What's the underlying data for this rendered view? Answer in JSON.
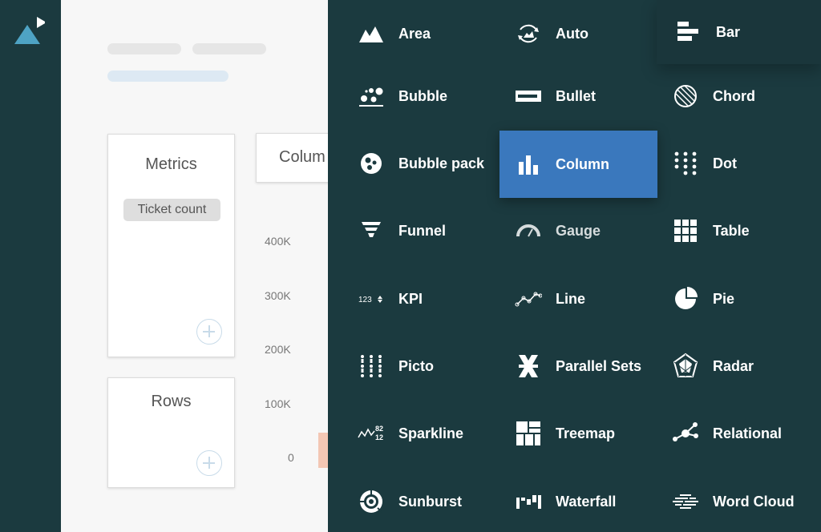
{
  "builder": {
    "metrics_title": "Metrics",
    "metric_chip": "Ticket count",
    "rows_title": "Rows",
    "column_title": "Colum",
    "y_ticks": [
      "400K",
      "300K",
      "200K",
      "100K",
      "0"
    ]
  },
  "picker": {
    "items": [
      {
        "label": "Area",
        "icon": "area-icon"
      },
      {
        "label": "Auto",
        "icon": "auto-icon"
      },
      {
        "label": "Bar",
        "icon": "bar-icon"
      },
      {
        "label": "Bubble",
        "icon": "bubble-icon"
      },
      {
        "label": "Bullet",
        "icon": "bullet-icon"
      },
      {
        "label": "Chord",
        "icon": "chord-icon"
      },
      {
        "label": "Bubble pack",
        "icon": "bubble-pack-icon"
      },
      {
        "label": "Column",
        "icon": "column-icon"
      },
      {
        "label": "Dot",
        "icon": "dot-icon"
      },
      {
        "label": "Funnel",
        "icon": "funnel-icon"
      },
      {
        "label": "Gauge",
        "icon": "gauge-icon"
      },
      {
        "label": "Table",
        "icon": "table-icon"
      },
      {
        "label": "KPI",
        "icon": "kpi-icon",
        "icon_text": "123"
      },
      {
        "label": "Line",
        "icon": "line-icon"
      },
      {
        "label": "Pie",
        "icon": "pie-icon"
      },
      {
        "label": "Picto",
        "icon": "picto-icon"
      },
      {
        "label": "Parallel Sets",
        "icon": "parallel-sets-icon"
      },
      {
        "label": "Radar",
        "icon": "radar-icon"
      },
      {
        "label": "Sparkline",
        "icon": "sparkline-icon",
        "icon_text_top": "82",
        "icon_text_bottom": "12"
      },
      {
        "label": "Treemap",
        "icon": "treemap-icon"
      },
      {
        "label": "Relational",
        "icon": "relational-icon"
      },
      {
        "label": "Sunburst",
        "icon": "sunburst-icon"
      },
      {
        "label": "Waterfall",
        "icon": "waterfall-icon"
      },
      {
        "label": "Word Cloud",
        "icon": "word-cloud-icon"
      }
    ],
    "selected": "Column"
  },
  "colors": {
    "rail": "#1b3a3f",
    "panel": "#1b3a3f",
    "selected": "#3a78bd",
    "logo_triangle": "#4ea3c4"
  }
}
